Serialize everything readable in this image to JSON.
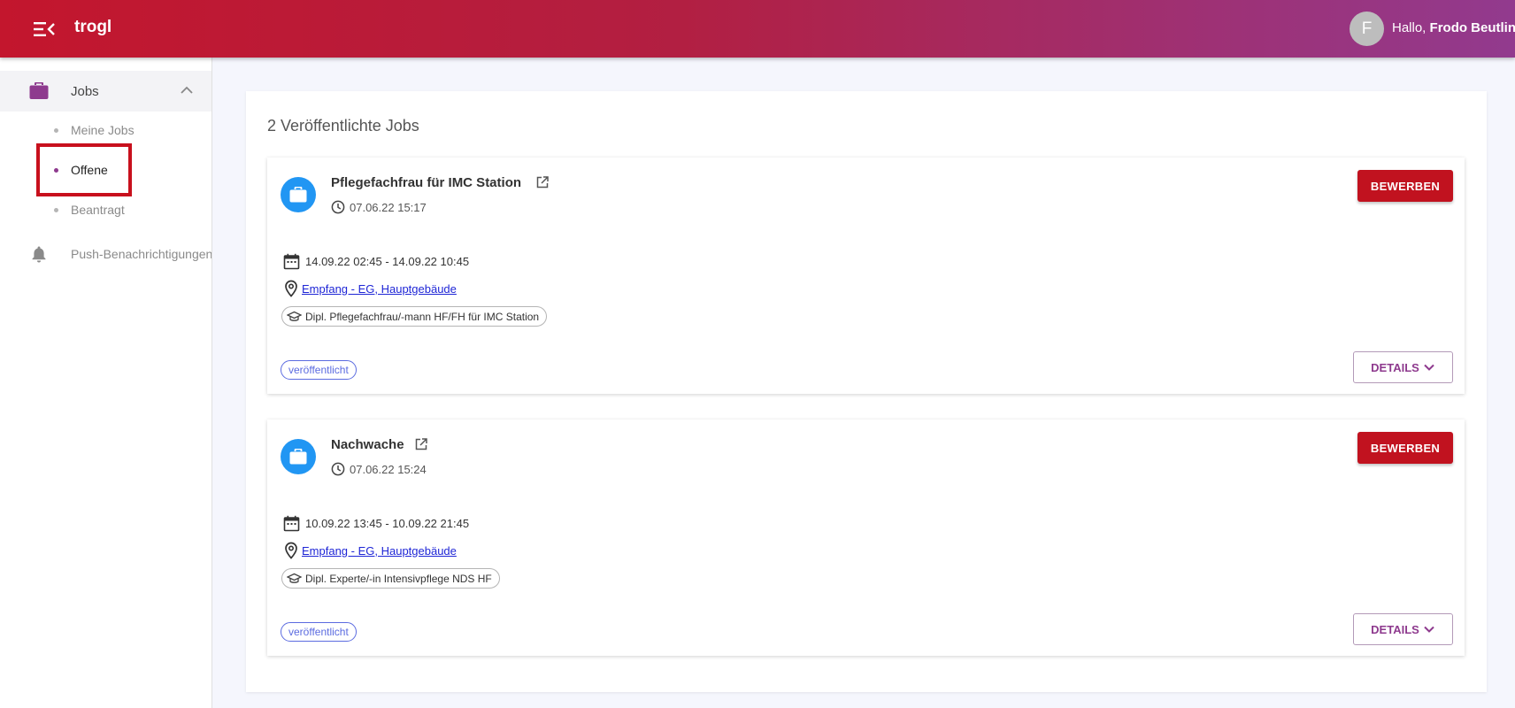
{
  "header": {
    "app_title": "trogl",
    "avatar_initial": "F",
    "greeting_prefix": "Hallo,",
    "user_name": "Frodo Beutlin"
  },
  "sidebar": {
    "group_label": "Jobs",
    "sub_items": [
      {
        "label": "Meine Jobs",
        "active": false
      },
      {
        "label": "Offene",
        "active": true
      },
      {
        "label": "Beantragt",
        "active": false
      }
    ],
    "push_label": "Push-Benachrichtigungen"
  },
  "main": {
    "title": "2 Veröffentlichte Jobs",
    "jobs": [
      {
        "title": "Pflegefachfrau für IMC Station",
        "created": "07.06.22 15:17",
        "period": "14.09.22 02:45 - 14.09.22 10:45",
        "location": "Empfang - EG, Hauptgebäude",
        "qualification": "Dipl. Pflegefachfrau/-mann HF/FH für IMC Station",
        "status": "veröffentlicht",
        "apply_label": "BEWERBEN",
        "details_label": "DETAILS"
      },
      {
        "title": "Nachwache",
        "created": "07.06.22 15:24",
        "period": "10.09.22 13:45 - 10.09.22 21:45",
        "location": "Empfang - EG, Hauptgebäude",
        "qualification": "Dipl. Experte/-in Intensivpflege NDS HF",
        "status": "veröffentlicht",
        "apply_label": "BEWERBEN",
        "details_label": "DETAILS"
      }
    ]
  },
  "colors": {
    "accent_red": "#c1121f",
    "accent_purple": "#8e3a8e",
    "job_avatar_blue": "#2196f3",
    "status_blue": "#5b6be0"
  },
  "icons": {
    "menu": "menu-collapse-icon",
    "jobs": "briefcase-icon",
    "push": "bell-icon",
    "external": "external-link-icon",
    "time": "clock-icon",
    "date": "calendar-icon",
    "location": "map-pin-icon",
    "qualification": "graduation-cap-icon",
    "details": "chevron-down-icon"
  }
}
